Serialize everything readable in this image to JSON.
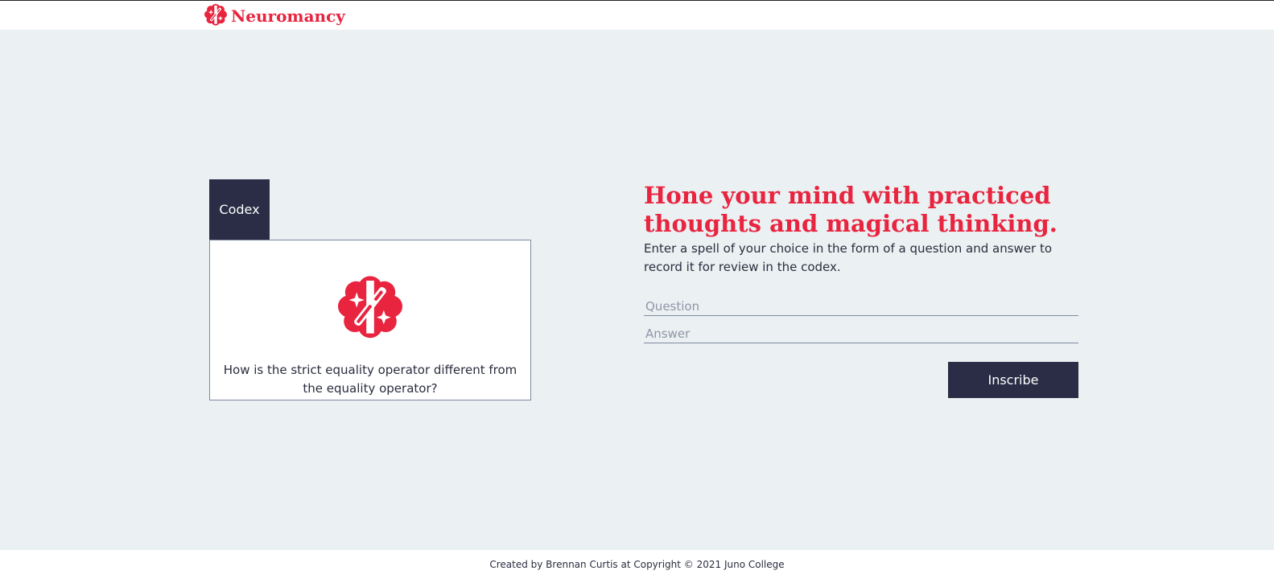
{
  "header": {
    "brand_name": "Neuromancy",
    "logo_icon": "brain-wand-icon"
  },
  "codex": {
    "tab_label": "Codex",
    "card_icon": "brain-wand-icon",
    "card_text": "How is the strict equality operator different from the equality operator?"
  },
  "form": {
    "headline": "Hone your mind with practiced thoughts and magical thinking.",
    "description": "Enter a spell of your choice in the form of a question and answer to record it for review in the codex.",
    "question_placeholder": "Question",
    "question_value": "",
    "answer_placeholder": "Answer",
    "answer_value": "",
    "submit_label": "Inscribe"
  },
  "footer": {
    "text": "Created by Brennan Curtis at Copyright © 2021 Juno College"
  },
  "colors": {
    "accent": "#e8243f",
    "dark": "#2a2d45",
    "background": "#ebf0f2"
  }
}
